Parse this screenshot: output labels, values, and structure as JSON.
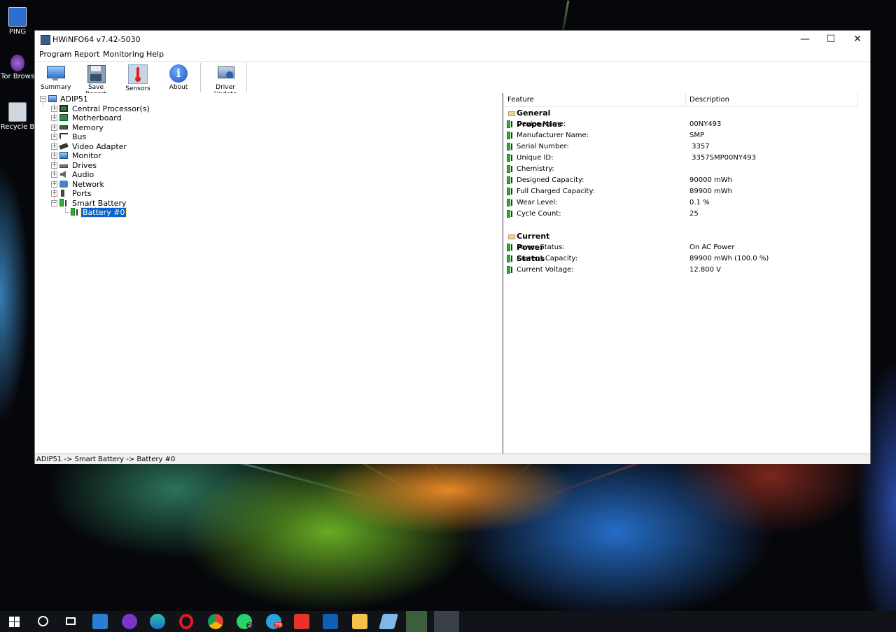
{
  "desktop": {
    "icons": [
      {
        "label": "PING",
        "icon": "ping-app-icon"
      },
      {
        "label": "Tor Brows",
        "icon": "tor-browser-icon"
      },
      {
        "label": "Recycle B",
        "icon": "recycle-bin-icon"
      }
    ]
  },
  "window": {
    "title": "HWiNFO64 v7.42-5030",
    "controls": {
      "minimize": "—",
      "maximize": "☐",
      "close": "✕"
    }
  },
  "menu": [
    "Program",
    "Report",
    "Monitoring",
    "Help"
  ],
  "toolbar": {
    "summary": "Summary",
    "save_report": "Save Report",
    "sensors": "Sensors",
    "about": "About",
    "driver_update": "Driver Update"
  },
  "tree": {
    "root": "ADIP51",
    "items": [
      {
        "label": "Central Processor(s)",
        "icon": "cpu-icon"
      },
      {
        "label": "Motherboard",
        "icon": "motherboard-icon"
      },
      {
        "label": "Memory",
        "icon": "memory-icon"
      },
      {
        "label": "Bus",
        "icon": "bus-icon"
      },
      {
        "label": "Video Adapter",
        "icon": "video-adapter-icon"
      },
      {
        "label": "Monitor",
        "icon": "monitor-icon"
      },
      {
        "label": "Drives",
        "icon": "drives-icon"
      },
      {
        "label": "Audio",
        "icon": "audio-icon"
      },
      {
        "label": "Network",
        "icon": "network-icon"
      },
      {
        "label": "Ports",
        "icon": "ports-icon"
      },
      {
        "label": "Smart Battery",
        "icon": "battery-icon"
      }
    ],
    "child": "Battery #0"
  },
  "details": {
    "headers": {
      "feature": "Feature",
      "description": "Description"
    },
    "general_title": "General Properties",
    "general": [
      {
        "feature": "Device Name:",
        "value": "00NY493"
      },
      {
        "feature": "Manufacturer Name:",
        "value": "SMP"
      },
      {
        "feature": "Serial Number:",
        "value": " 3357"
      },
      {
        "feature": "Unique ID:",
        "value": " 3357SMP00NY493"
      },
      {
        "feature": "Chemistry:",
        "value": ""
      },
      {
        "feature": "Designed Capacity:",
        "value": "90000 mWh"
      },
      {
        "feature": "Full Charged Capacity:",
        "value": "89900 mWh"
      },
      {
        "feature": "Wear Level:",
        "value": "0.1 %"
      },
      {
        "feature": "Cycle Count:",
        "value": "25"
      }
    ],
    "power_title": "Current Power Status",
    "power": [
      {
        "feature": "Power Status:",
        "value": "On AC Power"
      },
      {
        "feature": "Current Capacity:",
        "value": "89900 mWh (100.0 %)"
      },
      {
        "feature": "Current Voltage:",
        "value": "12.800 V"
      }
    ]
  },
  "status_bar": "ADIP51 -> Smart Battery -> Battery #0",
  "taskbar": {
    "badges": {
      "whatsapp": "2",
      "telegram": "79"
    }
  }
}
